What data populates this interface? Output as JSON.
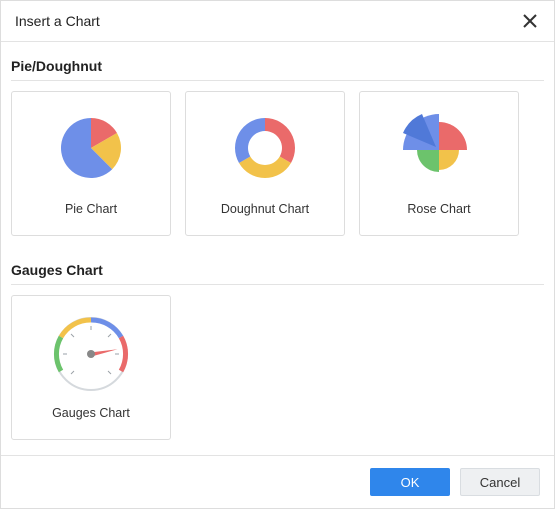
{
  "dialog": {
    "title": "Insert a Chart"
  },
  "sections": {
    "pie": {
      "title": "Pie/Doughnut",
      "items": {
        "pie": {
          "label": "Pie Chart"
        },
        "doughnut": {
          "label": "Doughnut Chart"
        },
        "rose": {
          "label": "Rose Chart"
        }
      }
    },
    "gauges": {
      "title": "Gauges Chart",
      "items": {
        "gauge": {
          "label": "Gauges Chart"
        }
      }
    }
  },
  "footer": {
    "ok_label": "OK",
    "cancel_label": "Cancel"
  },
  "palette": {
    "blue": "#6e8fe8",
    "blue2": "#5079d8",
    "red": "#ea6a6a",
    "yellow": "#f2c24a",
    "green": "#6cc36c",
    "grey": "#9aa1a8"
  }
}
